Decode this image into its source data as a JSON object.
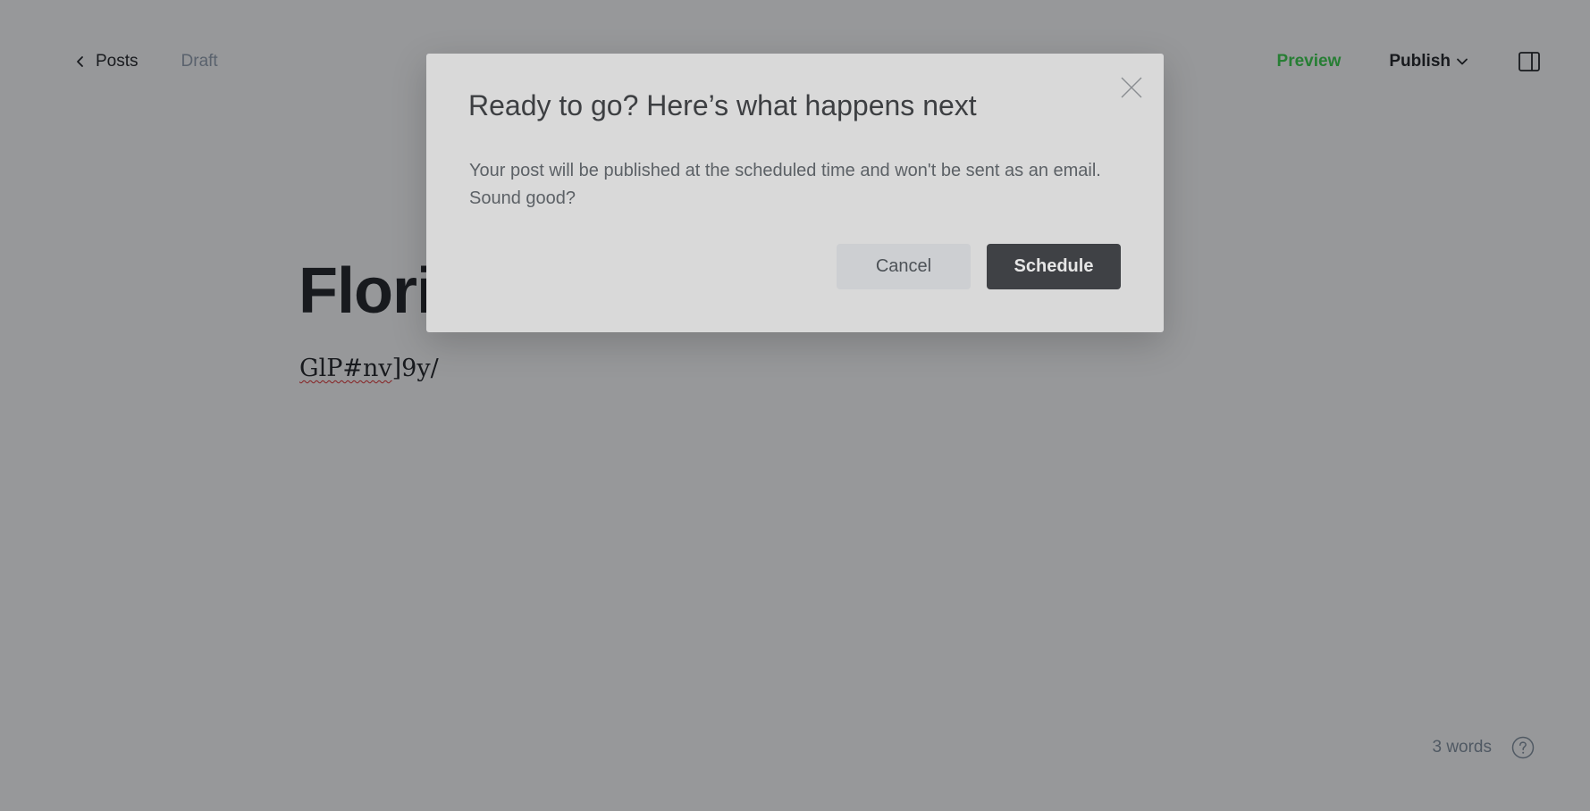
{
  "header": {
    "back_label": "Posts",
    "status": "Draft",
    "preview_label": "Preview",
    "publish_label": "Publish"
  },
  "editor": {
    "title": "Florine",
    "body": "GlP#nv]9y/",
    "body_misspelled_part": "GlP#nv",
    "body_rest": "]9y/"
  },
  "footer": {
    "word_count": "3 words"
  },
  "modal": {
    "title": "Ready to go? Here’s what happens next",
    "message": "Your post will be published at the scheduled time and won't be sent as an email. Sound good?",
    "cancel_label": "Cancel",
    "confirm_label": "Schedule"
  },
  "colors": {
    "accent_green": "#30cf43",
    "overlay": "rgba(28,30,34,0.46)",
    "modal_bg": "#d9d9d9",
    "primary_button": "#3f4145"
  },
  "icons": {
    "back": "chevron-left-icon",
    "publish_dropdown": "chevron-down-icon",
    "sidebar": "sidebar-toggle-icon",
    "close": "close-icon",
    "help": "help-icon"
  }
}
